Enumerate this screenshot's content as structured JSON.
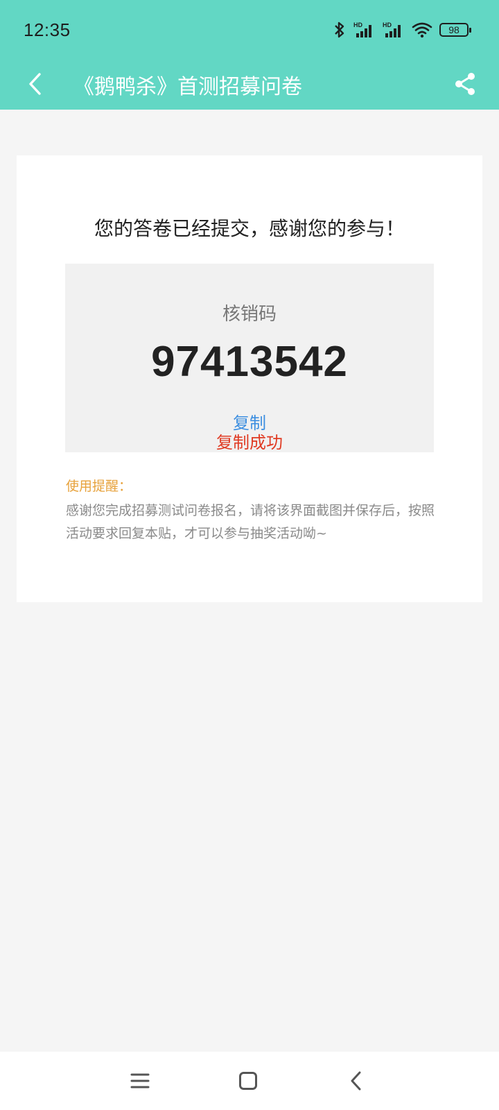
{
  "status_bar": {
    "time": "12:35",
    "battery": "98",
    "icons": [
      "bluetooth-icon",
      "hd-signal-icon",
      "hd-signal-icon",
      "wifi-icon",
      "battery-icon"
    ]
  },
  "app_bar": {
    "title": "《鹅鸭杀》首测招募问卷",
    "back_icon": "chevron-left-icon",
    "share_icon": "share-icon",
    "background_color": "#62d7c4"
  },
  "card": {
    "thanks_text": "您的答卷已经提交，感谢您的参与！",
    "code_label": "核销码",
    "code_value": "97413542",
    "copy_label": "复制",
    "copy_success": "复制成功",
    "reminder_title": "使用提醒：",
    "reminder_body": "感谢您完成招募测试问卷报名，请将该界面截图并保存后，按照活动要求回复本贴，才可以参与抽奖活动呦~"
  },
  "colors": {
    "accent": "#62d7c4",
    "link": "#3c8ee0",
    "success": "#e03a22",
    "reminder": "#e7a23c"
  },
  "nav_bar": {
    "icons": [
      "menu-icon",
      "home-icon",
      "back-icon"
    ]
  }
}
